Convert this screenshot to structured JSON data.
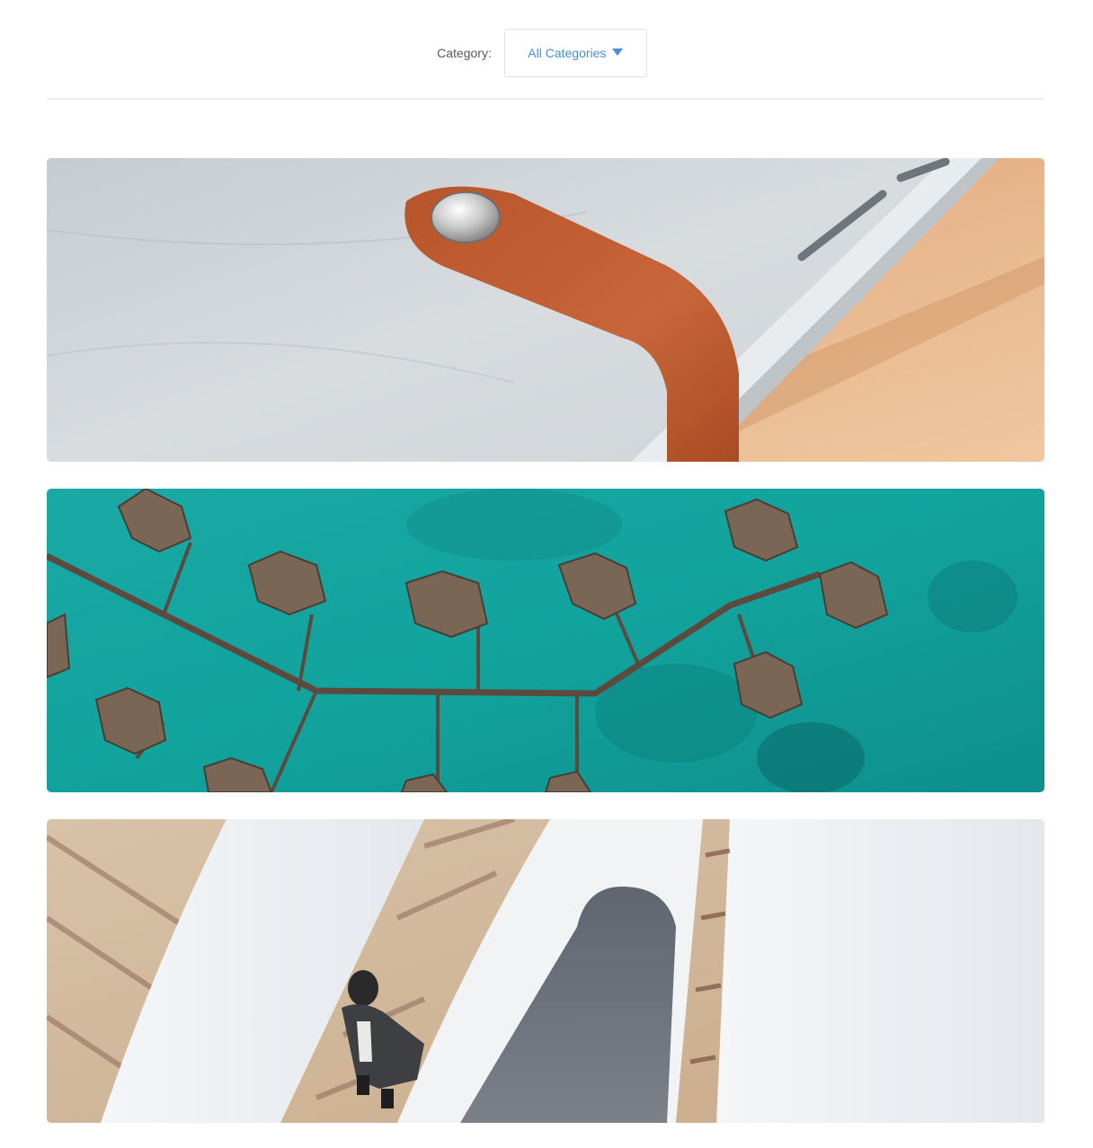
{
  "filter": {
    "label": "Category:",
    "selected": "All Categories",
    "caret_icon": "caret-down-icon",
    "accent_color": "#4a8fd9"
  },
  "gallery": {
    "items": [
      {
        "image": "felt-laptop-sleeve-leather-strap-photo"
      },
      {
        "image": "aerial-overwater-villas-turquoise-sea-photo"
      },
      {
        "image": "man-walking-white-architecture-staircase-photo"
      }
    ]
  }
}
